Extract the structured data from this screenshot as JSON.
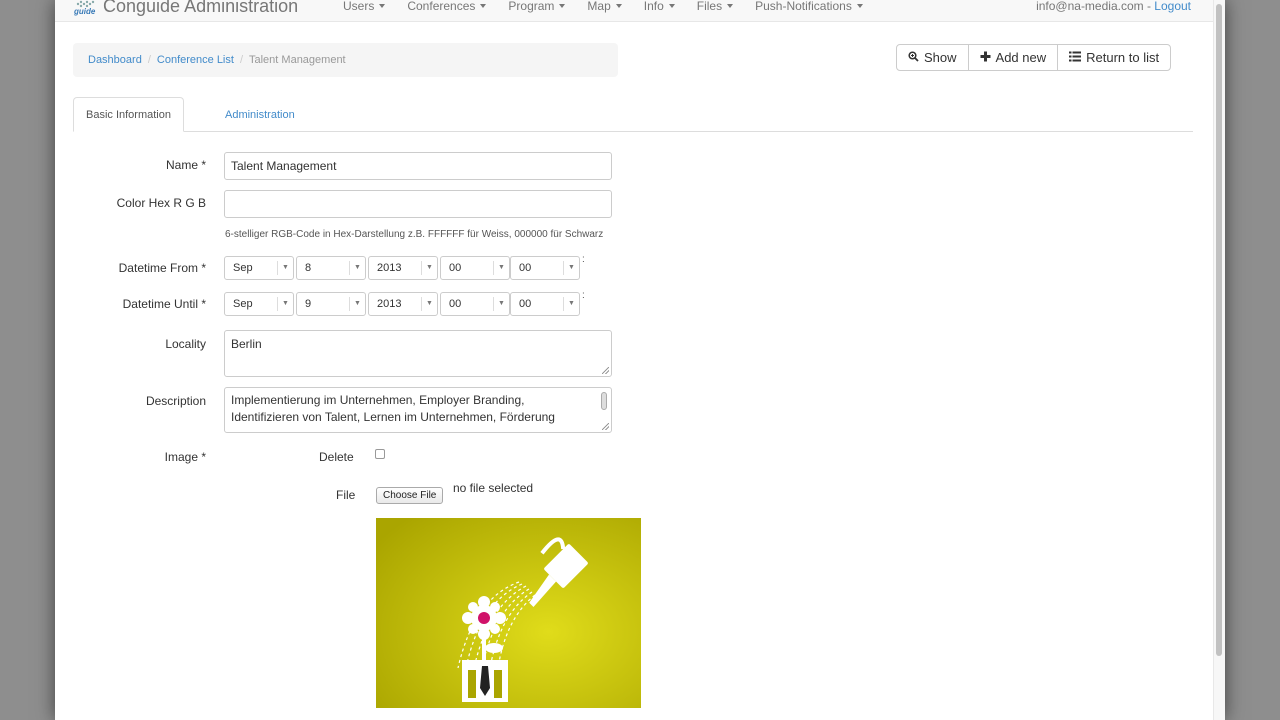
{
  "navbar": {
    "logo_word": "guide",
    "brand": "Conguide Administration",
    "menu": [
      {
        "label": "Users"
      },
      {
        "label": "Conferences"
      },
      {
        "label": "Program"
      },
      {
        "label": "Map"
      },
      {
        "label": "Info"
      },
      {
        "label": "Files"
      },
      {
        "label": "Push-Notifications"
      }
    ],
    "user_email": "info@na-media.com",
    "user_sep": " - ",
    "logout": "Logout"
  },
  "breadcrumb": {
    "items": [
      "Dashboard",
      "Conference List"
    ],
    "separator": "/",
    "current": "Talent Management"
  },
  "toolbar": {
    "show": "Show",
    "add_new": "Add new",
    "return": "Return to list"
  },
  "tabs": {
    "basic": "Basic Information",
    "admin": "Administration"
  },
  "form": {
    "name_label": "Name *",
    "name_value": "Talent Management",
    "color_label": "Color Hex R G B",
    "color_value": "",
    "color_help": "6-stelliger RGB-Code in Hex-Darstellung z.B. FFFFFF für Weiss, 000000 für Schwarz",
    "from_label": "Datetime From *",
    "from": {
      "month": "Sep",
      "day": "8",
      "year": "2013",
      "hour": "00",
      "minute": "00"
    },
    "until_label": "Datetime Until *",
    "until": {
      "month": "Sep",
      "day": "9",
      "year": "2013",
      "hour": "00",
      "minute": "00"
    },
    "time_colon": ":",
    "locality_label": "Locality",
    "locality_value": "Berlin",
    "description_label": "Description",
    "description_value": "Implementierung im Unternehmen, Employer Branding, Identifizieren von Talent, Lernen im Unternehmen, Förderung",
    "image_label": "Image *",
    "delete_label": "Delete",
    "file_label": "File",
    "choose_file": "Choose File",
    "no_file": "no file selected"
  },
  "colors": {
    "link": "#428bca",
    "image_bg": "#c4c000"
  },
  "icons": {
    "show": "zoom-icon",
    "add": "plus-icon",
    "return": "list-icon"
  }
}
